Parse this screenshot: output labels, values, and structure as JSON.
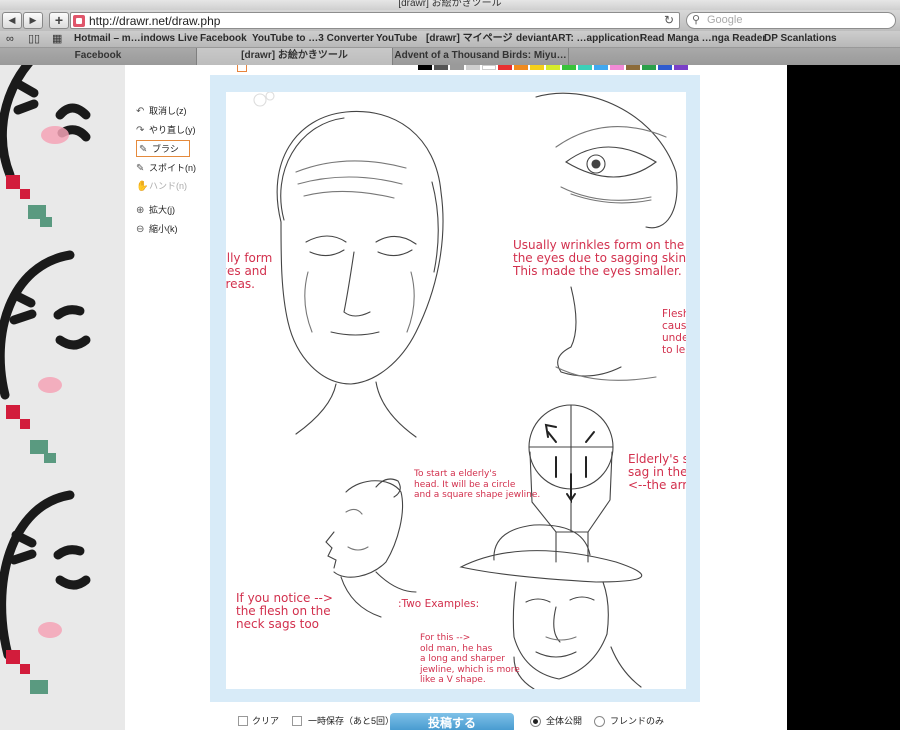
{
  "window": {
    "title": "[drawr] お絵かきツール"
  },
  "toolbar": {
    "back_icon": "◀",
    "forward_icon": "▶",
    "add_icon": "+",
    "url": "http://drawr.net/draw.php",
    "reload_icon": "↻",
    "search_icon": "⚲",
    "search_placeholder": "Google"
  },
  "bookmarks": {
    "reading_icon": "∞",
    "book_icon": "▯▯",
    "grid_icon": "▦",
    "items": [
      "Hotmail – m…indows Live",
      "Facebook",
      "YouTube to …3 Converter",
      "YouTube",
      "[drawr] マイページ",
      "deviantART: …application!",
      "Read Manga …nga Reader",
      "DP Scanlations"
    ]
  },
  "tabs": [
    {
      "label": "Facebook"
    },
    {
      "label": "[drawr] お絵かきツール"
    },
    {
      "label": "Advent of a Thousand Birds: Miyu…"
    }
  ],
  "palette": {
    "colors": [
      "#000000",
      "#555555",
      "#9a9a9a",
      "#cfcfcf",
      "#ffffff",
      "#e83030",
      "#f08a1e",
      "#f5d01a",
      "#d6ec2a",
      "#38c23a",
      "#3bd0b8",
      "#40a8f0",
      "#f28ad6",
      "#8c6b3a",
      "#2aa04a",
      "#2f5ccf",
      "#7a3fc8"
    ]
  },
  "tools": [
    {
      "icon": "↶",
      "label": "取消し(z)",
      "state": "normal"
    },
    {
      "icon": "↷",
      "label": "やり直し(y)",
      "state": "normal"
    },
    {
      "icon": "✎",
      "label": "ブラシ",
      "state": "selected"
    },
    {
      "icon": "✎",
      "label": "スポイト(n)",
      "state": "normal"
    },
    {
      "icon": "✋",
      "label": "ハンド(n)",
      "state": "disabled"
    },
    {
      "icon": "⊕",
      "label": "拡大(j)",
      "state": "normal"
    },
    {
      "icon": "⊖",
      "label": "縮小(k)",
      "state": "normal"
    }
  ],
  "drawing": {
    "notes": {
      "wrinkles": "Wrinkles usually form\naround the eyes and\nnose mouth areas.",
      "eyes": "Usually wrinkles form on the corner of\nthe eyes due to sagging skin.\nThis made the eyes smaller.",
      "flesh": "Flesh will sag which\ncause the distance\nunderneath the nose\nto lengthen.",
      "elderly_head": "To start a elderly's\nhead. It will be a circle\nand a square shape jewline.",
      "skin_direction": "Elderly's skin tend to\nsag in the direction of\n<--the arrows",
      "neck": "If you notice -->\nthe flesh on the\nneck sags too",
      "examples": ":Two Examples:",
      "old_man": "For this -->\nold man, he has\na long and sharper\njewline, which is more\nlike a V shape."
    }
  },
  "bottom": {
    "clear_label": "クリア",
    "temp_save_label": "一時保存（あと5回）",
    "post_label": "投稿する",
    "public_label": "全体公開",
    "friends_label": "フレンドのみ"
  }
}
